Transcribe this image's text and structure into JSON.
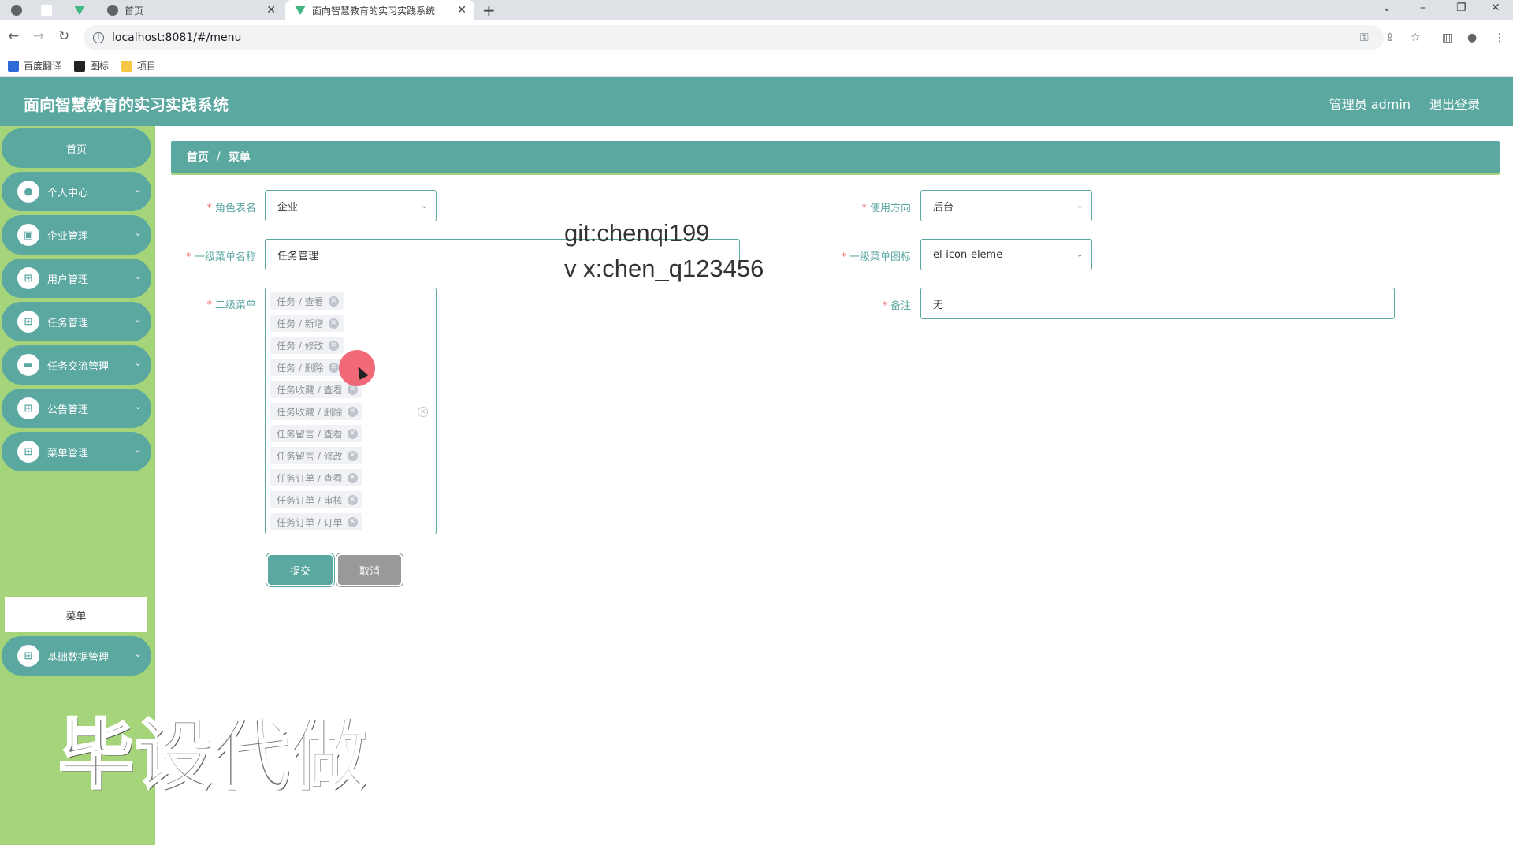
{
  "browser": {
    "tabs": [
      {
        "title": "首页"
      },
      {
        "title": "面向智慧教育的实习实践系统"
      }
    ],
    "url": "localhost:8081/#/menu",
    "bookmarks": [
      "百度翻译",
      "图标",
      "项目"
    ]
  },
  "header": {
    "title": "面向智慧教育的实习实践系统",
    "user": "管理员 admin",
    "logout": "退出登录"
  },
  "sidebar": {
    "home": "首页",
    "items": [
      {
        "label": "个人中心"
      },
      {
        "label": "企业管理"
      },
      {
        "label": "用户管理"
      },
      {
        "label": "任务管理"
      },
      {
        "label": "任务交流管理"
      },
      {
        "label": "公告管理"
      },
      {
        "label": "菜单管理"
      },
      {
        "label": "基础数据管理"
      }
    ],
    "active_sub": "菜单"
  },
  "breadcrumb": {
    "home": "首页",
    "sep": "/",
    "current": "菜单"
  },
  "form": {
    "role_label": "角色表名",
    "role_value": "企业",
    "direction_label": "使用方向",
    "direction_value": "后台",
    "menu_name_label": "一级菜单名称",
    "menu_name_value": "任务管理",
    "menu_icon_label": "一级菜单图标",
    "menu_icon_value": "el-icon-eleme",
    "submenu_label": "二级菜单",
    "submenus": [
      "任务 / 查看",
      "任务 / 新增",
      "任务 / 修改",
      "任务 / 删除",
      "任务收藏 / 查看",
      "任务收藏 / 删除",
      "任务留言 / 查看",
      "任务留言 / 修改",
      "任务订单 / 查看",
      "任务订单 / 审核",
      "任务订单 / 订单"
    ],
    "remark_label": "备注",
    "remark_value": "无",
    "submit": "提交",
    "cancel": "取消"
  },
  "watermarks": {
    "line1": "git:chenqi199",
    "line2": "v x:chen_q123456",
    "big": "毕设代做"
  },
  "colors": {
    "primary": "#5ba8a1",
    "sidebar_bg": "#a5d47a",
    "required": "#f56c6c"
  }
}
